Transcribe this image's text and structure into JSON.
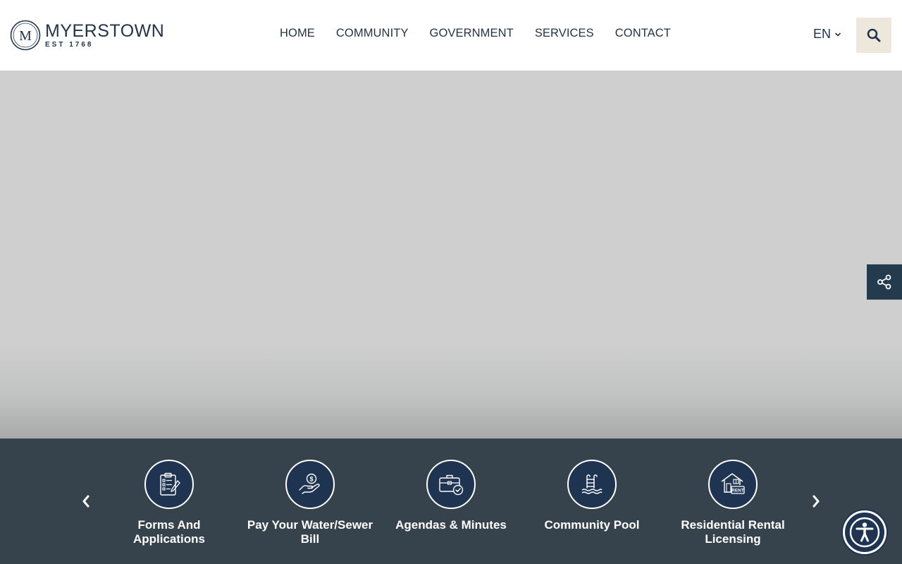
{
  "brand": {
    "name": "MYERSTOWN",
    "est": "EST 1768",
    "monogram": "M",
    "color": "#22344a"
  },
  "nav": {
    "items": [
      {
        "label": "HOME"
      },
      {
        "label": "COMMUNITY"
      },
      {
        "label": "GOVERNMENT"
      },
      {
        "label": "SERVICES"
      },
      {
        "label": "CONTACT"
      }
    ]
  },
  "header": {
    "language": "EN",
    "search_icon": "search-icon"
  },
  "share": {
    "icon": "share-icon"
  },
  "quicklinks": {
    "prev_icon": "chevron-left-icon",
    "next_icon": "chevron-right-icon",
    "items": [
      {
        "label": "Forms And Applications",
        "icon": "clipboard-icon"
      },
      {
        "label": "Pay Your Water/Sewer Bill",
        "icon": "hand-dollar-icon"
      },
      {
        "label": "Agendas & Minutes",
        "icon": "briefcase-check-icon"
      },
      {
        "label": "Community Pool",
        "icon": "pool-ladder-icon"
      },
      {
        "label": "Residential Rental Licensing",
        "icon": "house-rent-icon"
      }
    ],
    "rent_sign": "RENT"
  },
  "accessibility": {
    "icon": "accessibility-icon"
  },
  "colors": {
    "navy": "#1e3450",
    "dark_bar": "#36424c",
    "search_bg": "#eee8dc",
    "share_bg": "#243a4d"
  }
}
